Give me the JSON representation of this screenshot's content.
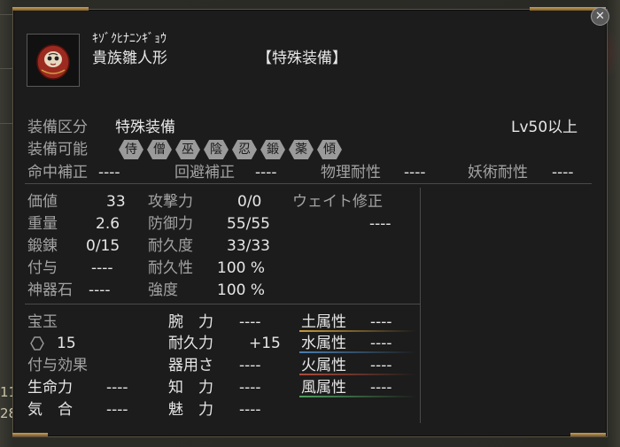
{
  "item": {
    "reading": "ｷｿﾞｸﾋﾅﾆﾝｷﾞｮｳ",
    "name": "貴族雛人形",
    "category_tag": "【特殊装備】"
  },
  "header": {
    "type_label": "装備区分",
    "type_value": "特殊装備",
    "level_req": "Lv50以上",
    "equippable_label": "装備可能",
    "jobs": [
      "侍",
      "僧",
      "巫",
      "陰",
      "忍",
      "鍛",
      "薬",
      "傾"
    ]
  },
  "secondary": [
    {
      "label": "命中補正",
      "value": "----"
    },
    {
      "label": "回避補正",
      "value": "----"
    },
    {
      "label": "物理耐性",
      "value": "----"
    },
    {
      "label": "妖術耐性",
      "value": "----"
    }
  ],
  "stats": {
    "value_label": "価値",
    "value": "33",
    "weight_label": "重量",
    "weight": "2.6",
    "forge_label": "鍛錬",
    "forge": "0/15",
    "grant_label": "付与",
    "grant": "----",
    "relic_label": "神器石",
    "relic": "----",
    "attack_label": "攻撃力",
    "attack": "0/0",
    "defense_label": "防御力",
    "defense": "55/55",
    "durability_label": "耐久度",
    "durability": "33/33",
    "dur_stat_label": "耐久性",
    "dur_stat": "100 %",
    "strength_label": "強度",
    "strength": "100 %",
    "weight_fix_label": "ウェイト修正",
    "weight_fix": "----"
  },
  "gems": {
    "label": "宝玉",
    "count": "15",
    "effect_label": "付与効果"
  },
  "attrs": [
    {
      "label": "腕　力",
      "value": "----"
    },
    {
      "label": "耐久力",
      "value": "+15"
    },
    {
      "label": "器用さ",
      "value": "----"
    },
    {
      "label": "知　力",
      "value": "----"
    },
    {
      "label": "魅　力",
      "value": "----"
    }
  ],
  "left_attrs": [
    {
      "label": "生命力",
      "value": "----"
    },
    {
      "label": "気　合",
      "value": "----"
    }
  ],
  "elements": [
    {
      "label": "土属性",
      "value": "----",
      "color": "#c89a3a"
    },
    {
      "label": "水属性",
      "value": "----",
      "color": "#4a7fb0"
    },
    {
      "label": "火属性",
      "value": "----",
      "color": "#b04a3a"
    },
    {
      "label": "風属性",
      "value": "----",
      "color": "#4fa060"
    }
  ],
  "edge_numbers": [
    "11",
    "28"
  ],
  "close_glyph": "✕"
}
